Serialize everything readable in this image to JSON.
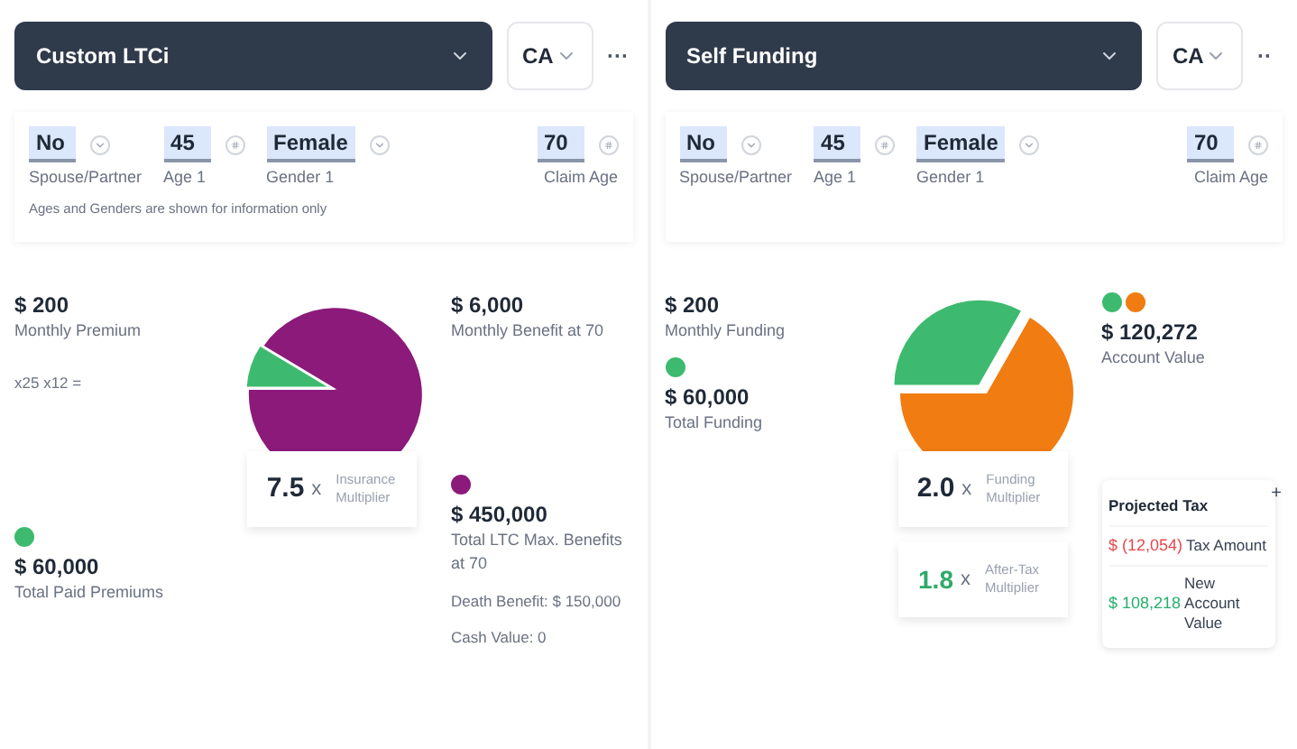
{
  "panels": [
    {
      "plan": "Custom LTCi",
      "state": "CA",
      "more": "···",
      "fields": [
        {
          "value": "No",
          "label": "Spouse/Partner",
          "kind": "select"
        },
        {
          "value": "45",
          "label": "Age 1",
          "kind": "number"
        },
        {
          "value": "Female",
          "label": "Gender 1",
          "kind": "select"
        }
      ],
      "claim": {
        "value": "70",
        "label": "Claim Age",
        "kind": "number"
      },
      "note": "Ages and Genders are shown for information only",
      "pie": {
        "kind": "ltc",
        "slices": [
          {
            "color": "#8b1a7a"
          },
          {
            "color": "#3dba6f"
          }
        ]
      },
      "left_groups": [
        [
          {
            "kind": "stat",
            "value": "$ 200",
            "label": "Monthly Premium"
          },
          {
            "kind": "note",
            "text": "x25 x12 ="
          }
        ],
        [
          {
            "kind": "stat",
            "value": "$ 60,000",
            "label": "Total Paid Premiums",
            "dots": [
              {
                "color": "#3dba6f"
              }
            ]
          }
        ]
      ],
      "right_groups": [
        [
          {
            "kind": "stat",
            "value": "$ 6,000",
            "label": "Monthly Benefit at 70"
          }
        ],
        [
          {
            "kind": "stat",
            "value": "$ 450,000",
            "label": "Total LTC Max. Benefits at 70",
            "dots": [
              {
                "color": "#8b1a7a"
              }
            ]
          },
          {
            "kind": "note",
            "text": "Death Benefit: $ 150,000"
          },
          {
            "kind": "note",
            "text": "Cash Value: 0"
          }
        ]
      ],
      "multipliers": [
        {
          "kind": "main",
          "value": "7.5",
          "unit": "x",
          "label": "Insurance Multiplier"
        }
      ]
    },
    {
      "plan": "Self Funding",
      "state": "CA",
      "more": "··",
      "fields": [
        {
          "value": "No",
          "label": "Spouse/Partner",
          "kind": "select"
        },
        {
          "value": "45",
          "label": "Age 1",
          "kind": "number"
        },
        {
          "value": "Female",
          "label": "Gender 1",
          "kind": "select"
        }
      ],
      "claim": {
        "value": "70",
        "label": "Claim Age",
        "kind": "number"
      },
      "pie": {
        "kind": "funding",
        "slices": [
          {
            "color": "#f07c12"
          },
          {
            "color": "#3dba6f"
          }
        ]
      },
      "left_groups": [
        [
          {
            "kind": "stat",
            "value": "$ 200",
            "label": "Monthly Funding"
          },
          {
            "kind": "stat",
            "value": "$ 60,000",
            "label": "Total Funding",
            "dots": [
              {
                "color": "#3dba6f"
              }
            ]
          }
        ]
      ],
      "right_groups": [
        [
          {
            "kind": "stat",
            "value": "$ 120,272",
            "label": "Account Value",
            "dots": [
              {
                "color": "#3dba6f"
              },
              {
                "color": "#f07c12"
              }
            ]
          }
        ],
        [
          {
            "kind": "tax",
            "title": "Projected Tax",
            "toggle": "+",
            "rows": [
              {
                "value": "$ (12,054)",
                "label": "Tax Amount",
                "kind": "negative"
              },
              {
                "value": "$ 108,218",
                "label": "New Account Value",
                "kind": "positive"
              }
            ]
          }
        ]
      ],
      "multipliers": [
        {
          "kind": "main",
          "value": "2.0",
          "unit": "x",
          "label": "Funding Multiplier"
        },
        {
          "kind": "after-tax",
          "value": "1.8",
          "unit": "x",
          "label": "After-Tax Multiplier"
        }
      ]
    }
  ]
}
